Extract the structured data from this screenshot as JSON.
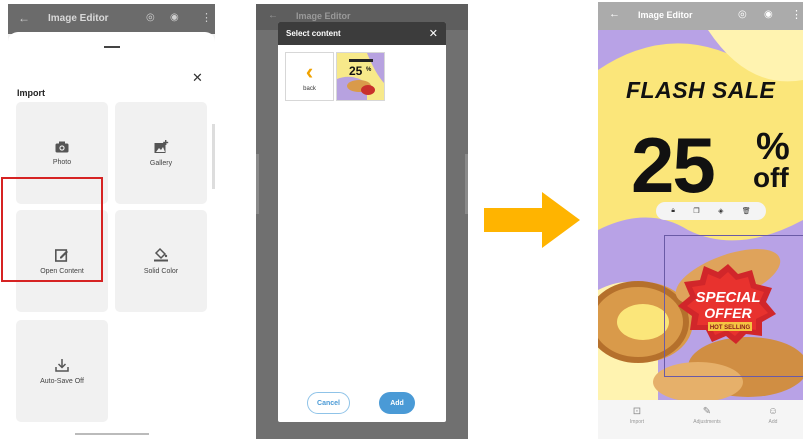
{
  "panel1": {
    "app_title": "Image Editor",
    "sheet_header": "Import",
    "tiles": [
      {
        "label": "Photo",
        "icon": "camera-icon"
      },
      {
        "label": "Gallery",
        "icon": "gallery-add-icon"
      },
      {
        "label": "Open Content",
        "icon": "edit-square-icon"
      },
      {
        "label": "Solid Color",
        "icon": "paint-bucket-icon"
      },
      {
        "label": "Auto-Save Off",
        "icon": "download-icon"
      }
    ],
    "close_glyph": "✕",
    "highlight_color": "#d62323"
  },
  "panel2": {
    "bg_title": "Image Editor",
    "dialog_title": "Select content",
    "close_glyph": "✕",
    "back_label": "back",
    "cancel_label": "Cancel",
    "add_label": "Add",
    "accent": "#4a9ad6"
  },
  "panel3": {
    "app_title": "Image Editor",
    "headline": "FLASH SALE",
    "discount": "25",
    "percent": "%",
    "off": "off",
    "badge_line1": "SPECIAL",
    "badge_line2": "OFFER",
    "badge_ribbon": "HOT SELLING",
    "bottom": [
      {
        "label": "Import",
        "icon": "import-icon"
      },
      {
        "label": "Adjustments",
        "icon": "edit-icon"
      },
      {
        "label": "Add",
        "icon": "add-sticker-icon"
      }
    ]
  },
  "arrow_color": "#ffb400"
}
